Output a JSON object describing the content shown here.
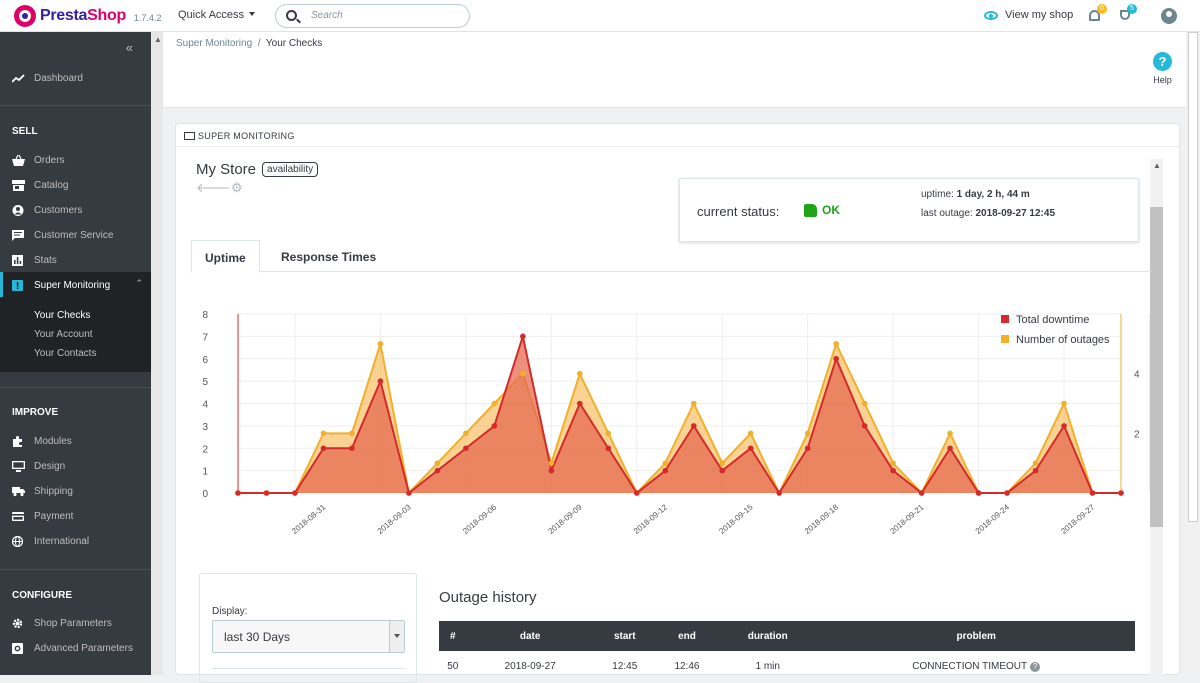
{
  "app": {
    "brand_a": "Presta",
    "brand_b": "Shop",
    "version": "1.7.4.2"
  },
  "topbar": {
    "quick_access": "Quick Access",
    "search_placeholder": "Search",
    "view_shop": "View my shop",
    "notif_count": "0",
    "orders_count": "5"
  },
  "sidebar": {
    "dashboard": "Dashboard",
    "sell": "SELL",
    "orders": "Orders",
    "catalog": "Catalog",
    "customers": "Customers",
    "customer_service": "Customer Service",
    "stats": "Stats",
    "super_monitoring": "Super Monitoring",
    "sub": [
      "Your Checks",
      "Your Account",
      "Your Contacts"
    ],
    "improve": "IMPROVE",
    "modules": "Modules",
    "design": "Design",
    "shipping": "Shipping",
    "payment": "Payment",
    "international": "International",
    "configure": "CONFIGURE",
    "shop_parameters": "Shop Parameters",
    "advanced_parameters": "Advanced Parameters"
  },
  "breadcrumb": {
    "parent": "Super Monitoring",
    "sep": "/",
    "current": "Your Checks"
  },
  "help": "Help",
  "panel": {
    "title": "SUPER MONITORING",
    "store_name": "My Store",
    "store_tag": "availability",
    "status_label": "current status:",
    "status_value": "OK",
    "uptime_label": "uptime:",
    "uptime_value": "1 day, 2 h, 44 m",
    "last_outage_label": "last outage:",
    "last_outage_value": "2018-09-27 12:45",
    "tabs": [
      "Uptime",
      "Response Times"
    ]
  },
  "colors": {
    "downtime": "#d42a2a",
    "outages": "#f0b02a",
    "accent": "#25b9d7",
    "ok": "#1ea419"
  },
  "chart_data": {
    "type": "area",
    "x": [
      "2018-08-28",
      "2018-08-29",
      "2018-08-30",
      "2018-08-31",
      "2018-09-01",
      "2018-09-02",
      "2018-09-03",
      "2018-09-04",
      "2018-09-05",
      "2018-09-06",
      "2018-09-07",
      "2018-09-08",
      "2018-09-09",
      "2018-09-10",
      "2018-09-11",
      "2018-09-12",
      "2018-09-13",
      "2018-09-14",
      "2018-09-15",
      "2018-09-16",
      "2018-09-17",
      "2018-09-18",
      "2018-09-19",
      "2018-09-20",
      "2018-09-21",
      "2018-09-22",
      "2018-09-23",
      "2018-09-24",
      "2018-09-25",
      "2018-09-26",
      "2018-09-27",
      "2018-09-28",
      "2018-09-29"
    ],
    "x_ticks": [
      "2018-08-31",
      "2018-09-03",
      "2018-09-06",
      "2018-09-09",
      "2018-09-12",
      "2018-09-15",
      "2018-09-18",
      "2018-09-21",
      "2018-09-24",
      "2018-09-27"
    ],
    "series": [
      {
        "name": "Total downtime",
        "axis": "left",
        "values": [
          0,
          0,
          0,
          2,
          2,
          5,
          0,
          1,
          2,
          3,
          7,
          1,
          4,
          2,
          0,
          1,
          3,
          1,
          2,
          0,
          2,
          6,
          3,
          1,
          0,
          2,
          0,
          0,
          1,
          3,
          0,
          0
        ]
      },
      {
        "name": "Number of outages",
        "axis": "right",
        "values": [
          0,
          0,
          0,
          2,
          2,
          5,
          0,
          1,
          2,
          3,
          4,
          1,
          4,
          2,
          0,
          1,
          3,
          1,
          2,
          0,
          2,
          5,
          3,
          1,
          0,
          2,
          0,
          0,
          1,
          3,
          0,
          0
        ]
      }
    ],
    "ylim_left": [
      0,
      8
    ],
    "ylim_right": [
      0,
      6
    ],
    "y_ticks_left": [
      0,
      1,
      2,
      3,
      4,
      5,
      6,
      7,
      8
    ],
    "y_ticks_right": [
      2,
      4
    ],
    "legend": "top-right",
    "grid": true
  },
  "filter": {
    "label": "Display:",
    "value": "last 30 Days"
  },
  "outages": {
    "title": "Outage history",
    "columns": [
      "#",
      "date",
      "start",
      "end",
      "duration",
      "problem"
    ],
    "rows": [
      [
        "50",
        "2018-09-27",
        "12:45",
        "12:46",
        "1 min",
        "CONNECTION TIMEOUT"
      ]
    ]
  }
}
